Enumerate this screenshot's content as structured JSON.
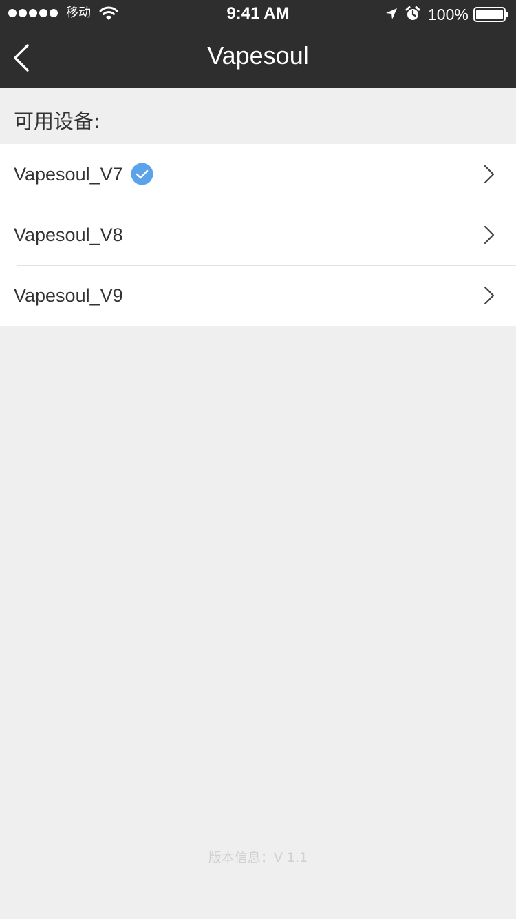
{
  "status_bar": {
    "carrier": "移动",
    "time": "9:41 AM",
    "battery": "100%"
  },
  "nav": {
    "title": "Vapesoul",
    "back_icon": "chevron-left-icon"
  },
  "section_label": "可用设备:",
  "devices": [
    {
      "name": "Vapesoul_V7",
      "connected": true
    },
    {
      "name": "Vapesoul_V8",
      "connected": false
    },
    {
      "name": "Vapesoul_V9",
      "connected": false
    }
  ],
  "footer": {
    "version": "版本信息：V 1.1"
  },
  "colors": {
    "header_bg": "#2e2e2e",
    "page_bg": "#efefef",
    "check_blue": "#5aa2ea"
  }
}
